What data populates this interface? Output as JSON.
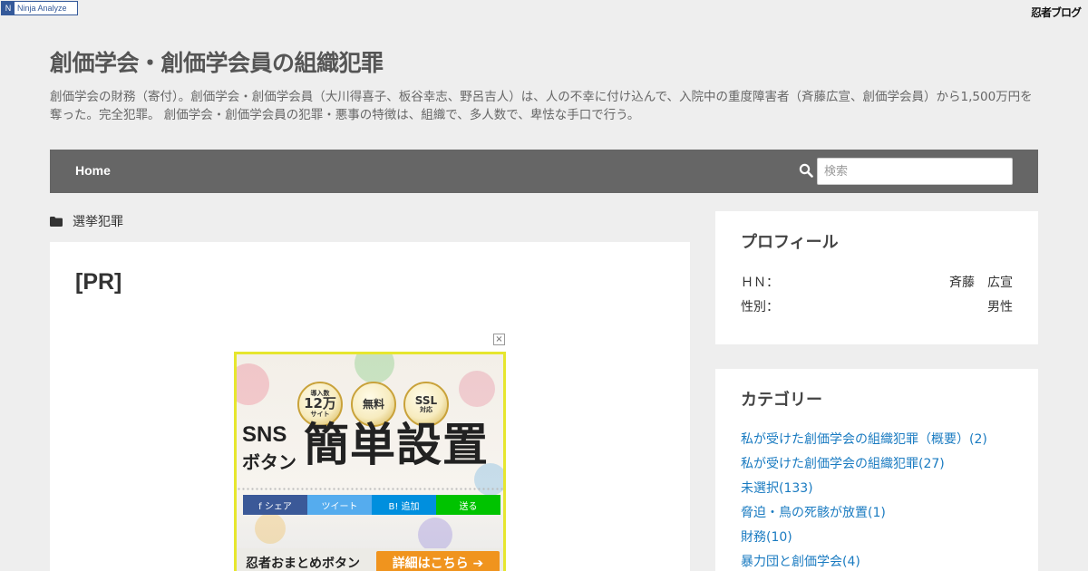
{
  "topbar": {
    "ninja_label": "Ninja Analyze",
    "blog_logo": "忍者ブログ"
  },
  "header": {
    "title": "創価学会・創価学会員の組織犯罪",
    "description": "創価学会の財務（寄付）。創価学会・創価学会員（大川得喜子、板谷幸志、野呂吉人）は、人の不幸に付け込んで、入院中の重度障害者（斉藤広宣、創価学会員）から1,500万円を奪った。完全犯罪。 創価学会・創価学会員の犯罪・悪事の特徴は、組織で、多人数で、卑怯な手口で行う。"
  },
  "nav": {
    "home_label": "Home",
    "search_placeholder": "検索",
    "search_icon": "search-icon"
  },
  "breadcrumb": {
    "icon": "folder-icon",
    "label": "選挙犯罪"
  },
  "main": {
    "title": "[PR]",
    "ad": {
      "close_label": "×",
      "medal_1_top": "導入数",
      "medal_1_big": "12万",
      "medal_1_bottom": "サイト",
      "medal_2": "無料",
      "medal_3_top": "SSL",
      "medal_3_bottom": "対応",
      "sns_label": "SNS",
      "button_label": "ボタン",
      "headline": "簡単設置",
      "share_buttons": [
        {
          "label": "f  シェア",
          "color": "#3b5998"
        },
        {
          "label": "ツイート",
          "color": "#55acee"
        },
        {
          "label": "B!  追加",
          "color": "#008fde"
        },
        {
          "label": "送る",
          "color": "#00c300"
        }
      ],
      "footer_label": "忍者おまとめボタン",
      "footer_button": "詳細はこちら ➔"
    }
  },
  "sidebar": {
    "profile": {
      "heading": "プロフィール",
      "rows": [
        {
          "label": "ＨＮ：",
          "value": "斉藤　広宣"
        },
        {
          "label": "性別：",
          "value": "男性"
        }
      ]
    },
    "categories": {
      "heading": "カテゴリー",
      "items": [
        "私が受けた創価学会の組織犯罪（概要）(2)",
        "私が受けた創価学会の組織犯罪(27)",
        "未選択(133)",
        "脅迫・鳥の死骸が放置(1)",
        "財務(10)",
        "暴力団と創価学会(4)"
      ]
    }
  },
  "colors": {
    "background": "#eeeeee",
    "navbar": "#666666",
    "link": "#1a7bc1",
    "ad_border": "#e6e62e",
    "ad_button": "#f0941e"
  }
}
